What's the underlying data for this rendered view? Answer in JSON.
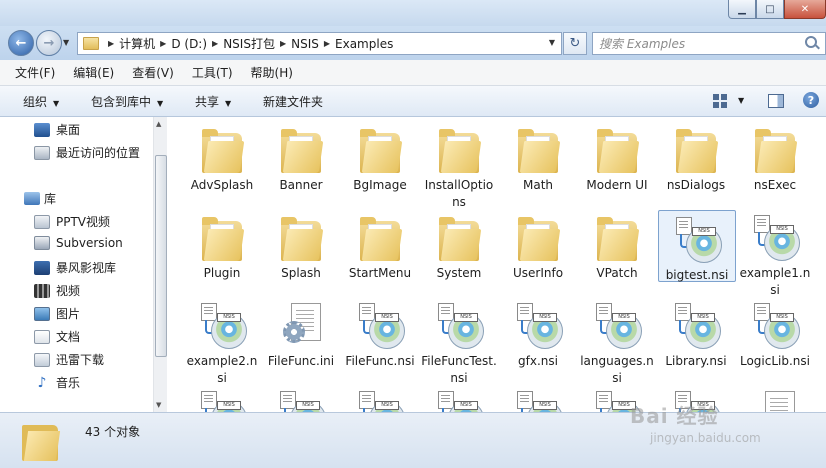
{
  "window": {
    "minimize": "▁",
    "maximize": "□",
    "close": "✕"
  },
  "nav": {
    "breadcrumbs": [
      "计算机",
      "D (D:)",
      "NSIS打包",
      "NSIS",
      "Examples"
    ],
    "search_placeholder": "搜索 Examples"
  },
  "menubar": [
    "文件(F)",
    "编辑(E)",
    "查看(V)",
    "工具(T)",
    "帮助(H)"
  ],
  "toolbar": {
    "organize": "组织",
    "include_library": "包含到库中",
    "share": "共享",
    "new_folder": "新建文件夹"
  },
  "sidebar": {
    "favorites": [
      {
        "label": "桌面",
        "icon": "desktop-icon"
      },
      {
        "label": "最近访问的位置",
        "icon": "recent-places-icon"
      }
    ],
    "library_label": "库",
    "libraries": [
      {
        "label": "PPTV视频",
        "icon": "video-library-icon"
      },
      {
        "label": "Subversion",
        "icon": "subversion-icon"
      },
      {
        "label": "暴风影视库",
        "icon": "video-library-icon"
      },
      {
        "label": "视频",
        "icon": "video-icon"
      },
      {
        "label": "图片",
        "icon": "pictures-icon"
      },
      {
        "label": "文档",
        "icon": "documents-icon"
      },
      {
        "label": "迅雷下载",
        "icon": "downloads-icon"
      },
      {
        "label": "音乐",
        "icon": "music-icon"
      }
    ]
  },
  "files": [
    {
      "name": "AdvSplash",
      "type": "folder"
    },
    {
      "name": "Banner",
      "type": "folder"
    },
    {
      "name": "BgImage",
      "type": "folder"
    },
    {
      "name": "InstallOptions",
      "type": "folder"
    },
    {
      "name": "Math",
      "type": "folder"
    },
    {
      "name": "Modern UI",
      "type": "folder"
    },
    {
      "name": "nsDialogs",
      "type": "folder"
    },
    {
      "name": "nsExec",
      "type": "folder"
    },
    {
      "name": "Plugin",
      "type": "folder"
    },
    {
      "name": "Splash",
      "type": "folder"
    },
    {
      "name": "StartMenu",
      "type": "folder"
    },
    {
      "name": "System",
      "type": "folder"
    },
    {
      "name": "UserInfo",
      "type": "folder"
    },
    {
      "name": "VPatch",
      "type": "folder"
    },
    {
      "name": "bigtest.nsi",
      "type": "nsi",
      "selected": true
    },
    {
      "name": "example1.nsi",
      "type": "nsi"
    },
    {
      "name": "example2.nsi",
      "type": "nsi"
    },
    {
      "name": "FileFunc.ini",
      "type": "ini"
    },
    {
      "name": "FileFunc.nsi",
      "type": "nsi"
    },
    {
      "name": "FileFuncTest.nsi",
      "type": "nsi"
    },
    {
      "name": "gfx.nsi",
      "type": "nsi"
    },
    {
      "name": "languages.nsi",
      "type": "nsi"
    },
    {
      "name": "Library.nsi",
      "type": "nsi"
    },
    {
      "name": "LogicLib.nsi",
      "type": "nsi"
    }
  ],
  "status": {
    "count": "43 个对象"
  },
  "watermark": {
    "line1": "Bai 经验",
    "line2": "jingyan.baidu.com"
  },
  "colors": {
    "accent": "#2d5fa6",
    "selection": "#e8f1fb"
  }
}
